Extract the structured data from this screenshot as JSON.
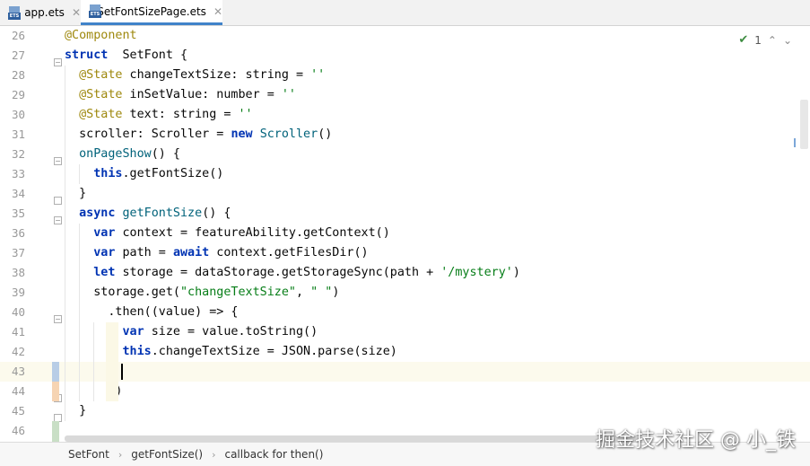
{
  "tabs": [
    {
      "label": "app.ets",
      "icon": "ets-file-icon",
      "icon_text": "ETS"
    },
    {
      "label": "SetFontSizePage.ets",
      "icon": "ets-file-icon",
      "icon_text": "ETS",
      "active": true
    }
  ],
  "inspection": {
    "count": "1",
    "status_icon": "check-icon"
  },
  "code_lines": [
    {
      "n": "26",
      "tokens": [
        [
          "an",
          "@Component"
        ]
      ]
    },
    {
      "n": "27",
      "tokens": [
        [
          "kw",
          "struct"
        ],
        [
          "",
          "  SetFont {"
        ]
      ]
    },
    {
      "n": "28",
      "tokens": [
        [
          "",
          "  "
        ],
        [
          "an",
          "@State"
        ],
        [
          "",
          " changeTextSize: string = "
        ],
        [
          "str",
          "''"
        ]
      ]
    },
    {
      "n": "29",
      "tokens": [
        [
          "",
          "  "
        ],
        [
          "an",
          "@State"
        ],
        [
          "",
          " inSetValue: number = "
        ],
        [
          "str",
          "''"
        ]
      ]
    },
    {
      "n": "30",
      "tokens": [
        [
          "",
          "  "
        ],
        [
          "an",
          "@State"
        ],
        [
          "",
          " text: string = "
        ],
        [
          "str",
          "''"
        ]
      ]
    },
    {
      "n": "31",
      "tokens": [
        [
          "",
          "  scroller: Scroller = "
        ],
        [
          "kw",
          "new"
        ],
        [
          "",
          " "
        ],
        [
          "fn",
          "Scroller"
        ],
        [
          "",
          "()"
        ]
      ]
    },
    {
      "n": "32",
      "tokens": [
        [
          "",
          "  "
        ],
        [
          "fn",
          "onPageShow"
        ],
        [
          "",
          "() {"
        ]
      ]
    },
    {
      "n": "33",
      "tokens": [
        [
          "",
          "    "
        ],
        [
          "kw",
          "this"
        ],
        [
          "",
          ".getFontSize()"
        ]
      ]
    },
    {
      "n": "34",
      "tokens": [
        [
          "",
          "  }"
        ]
      ]
    },
    {
      "n": "35",
      "tokens": [
        [
          "",
          "  "
        ],
        [
          "kw",
          "async"
        ],
        [
          "",
          " "
        ],
        [
          "fn",
          "getFontSize"
        ],
        [
          "",
          "() {"
        ]
      ]
    },
    {
      "n": "36",
      "tokens": [
        [
          "",
          "    "
        ],
        [
          "kw",
          "var"
        ],
        [
          "",
          " context = featureAbility.getContext()"
        ]
      ]
    },
    {
      "n": "37",
      "tokens": [
        [
          "",
          "    "
        ],
        [
          "kw",
          "var"
        ],
        [
          "",
          " path = "
        ],
        [
          "kw",
          "await"
        ],
        [
          "",
          " context.getFilesDir()"
        ]
      ]
    },
    {
      "n": "38",
      "tokens": [
        [
          "",
          "    "
        ],
        [
          "kw",
          "let"
        ],
        [
          "",
          " storage = dataStorage.getStorageSync(path + "
        ],
        [
          "str",
          "'/mystery'"
        ],
        [
          "",
          ")"
        ]
      ]
    },
    {
      "n": "39",
      "tokens": [
        [
          "",
          "    storage.get("
        ],
        [
          "str",
          "\"changeTextSize\""
        ],
        [
          "",
          ", "
        ],
        [
          "str",
          "\" \""
        ],
        [
          "",
          ")"
        ]
      ]
    },
    {
      "n": "40",
      "tokens": [
        [
          "",
          "      .then((value) => {"
        ]
      ]
    },
    {
      "n": "41",
      "tokens": [
        [
          "",
          "        "
        ],
        [
          "kw",
          "var"
        ],
        [
          "",
          " size = value.toString()"
        ]
      ]
    },
    {
      "n": "42",
      "tokens": [
        [
          "",
          "        "
        ],
        [
          "kw",
          "this"
        ],
        [
          "",
          ".changeTextSize = JSON.parse(size)"
        ]
      ]
    },
    {
      "n": "43",
      "tokens": [
        [
          "",
          ""
        ]
      ]
    },
    {
      "n": "44",
      "tokens": [
        [
          "",
          "      })"
        ]
      ]
    },
    {
      "n": "45",
      "tokens": [
        [
          "",
          "  }"
        ]
      ]
    },
    {
      "n": "46",
      "tokens": [
        [
          "",
          ""
        ]
      ]
    }
  ],
  "breadcrumb": [
    "SetFont",
    "getFontSize()",
    "callback for then()"
  ],
  "watermark": "掘金技术社区 @ 小_铁",
  "colors": {
    "keyword": "#0033b3",
    "annotation": "#9e880d",
    "string": "#067d17",
    "function": "#00627a",
    "tab_underline": "#4083c9"
  }
}
